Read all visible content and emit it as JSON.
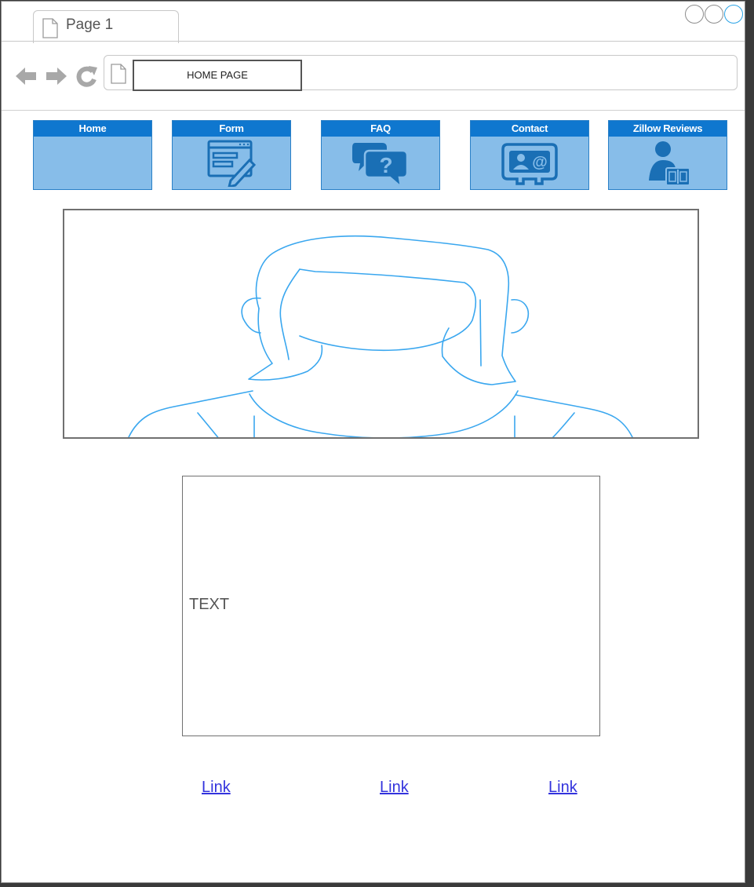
{
  "tab": {
    "title": "Page 1"
  },
  "address_bar": {
    "value": "HOME PAGE"
  },
  "menu": [
    {
      "label": "Home",
      "icon": "none"
    },
    {
      "label": "Form",
      "icon": "form-pencil-icon"
    },
    {
      "label": "FAQ",
      "icon": "faq-speech-bubble-icon"
    },
    {
      "label": "Contact",
      "icon": "contact-card-icon"
    },
    {
      "label": "Zillow Reviews",
      "icon": "user-book-icon"
    }
  ],
  "hero": {
    "icon": "person-illustration"
  },
  "content": {
    "text": "TEXT"
  },
  "footer": {
    "links": [
      "Link",
      "Link",
      "Link"
    ]
  },
  "colors": {
    "accent": "#0f77cf",
    "menu_fill": "#87bde9",
    "line_art": "#3aa7ef",
    "link": "#3333dd"
  }
}
